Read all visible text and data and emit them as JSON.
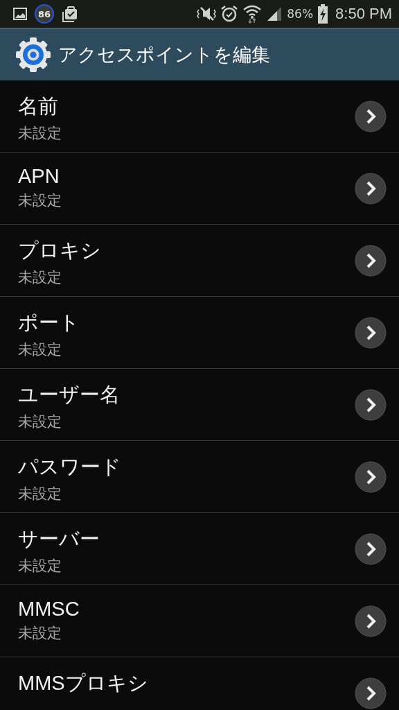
{
  "status_bar": {
    "badge": "86",
    "battery": "86%",
    "time": "8:50 PM"
  },
  "header": {
    "title": "アクセスポイントを編集"
  },
  "items": [
    {
      "title": "名前",
      "value": "未設定"
    },
    {
      "title": "APN",
      "value": "未設定"
    },
    {
      "title": "プロキシ",
      "value": "未設定"
    },
    {
      "title": "ポート",
      "value": "未設定"
    },
    {
      "title": "ユーザー名",
      "value": "未設定"
    },
    {
      "title": "パスワード",
      "value": "未設定"
    },
    {
      "title": "サーバー",
      "value": "未設定"
    },
    {
      "title": "MMSC",
      "value": "未設定"
    },
    {
      "title": "MMSプロキシ"
    }
  ]
}
